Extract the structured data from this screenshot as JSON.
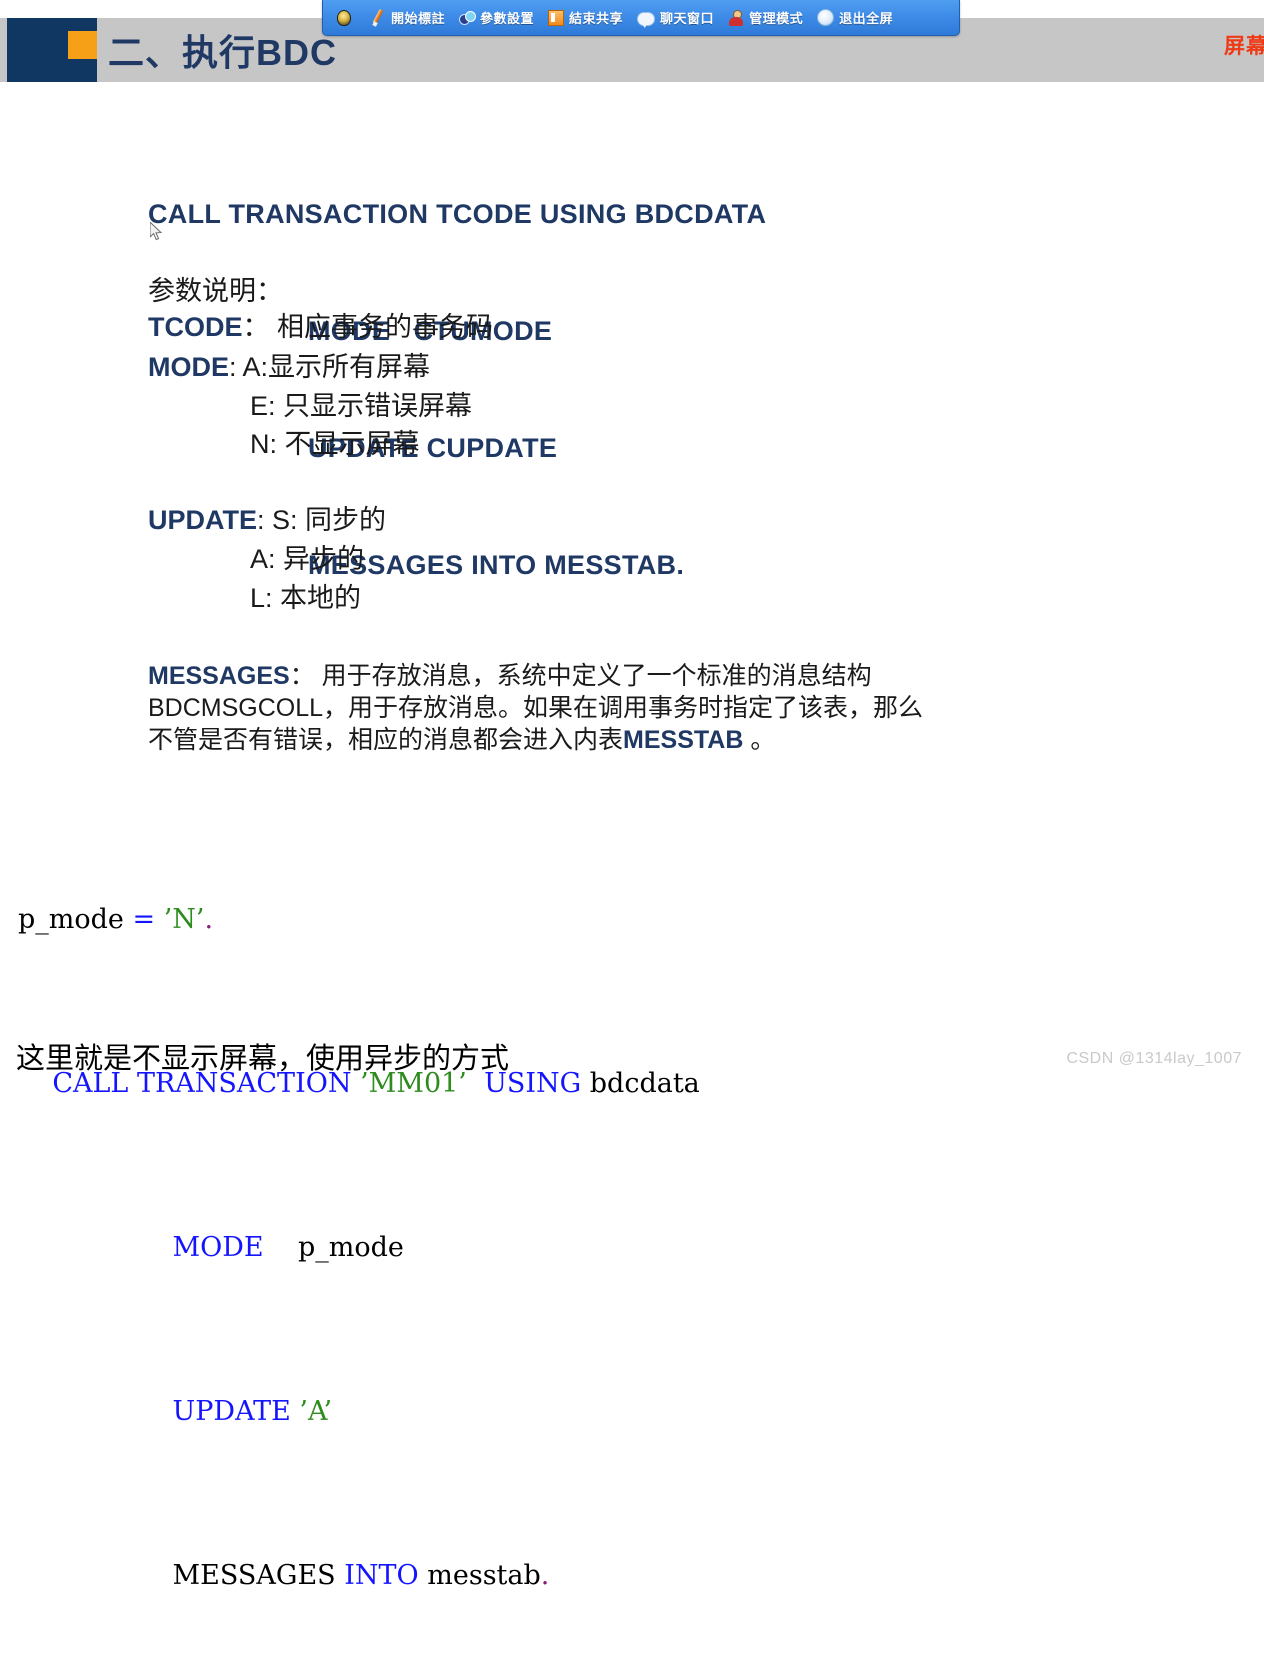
{
  "toolbar": {
    "items": [
      {
        "label": "",
        "icon": "pin-icon"
      },
      {
        "label": "開始標註",
        "icon": "pen-icon"
      },
      {
        "label": "參數設置",
        "icon": "settings-icon"
      },
      {
        "label": "結束共享",
        "icon": "stop-share-icon"
      },
      {
        "label": "聊天窗口",
        "icon": "chat-icon"
      },
      {
        "label": "管理模式",
        "icon": "admin-person-icon"
      },
      {
        "label": "退出全屏",
        "icon": "exit-fullscreen-icon"
      }
    ]
  },
  "header": {
    "title": "二、执行BDC",
    "right_text": "屏幕",
    "navy_color": "#103662",
    "accent_color": "#f5a017",
    "band_color": "#c6c6c6",
    "title_color": "#1f3864"
  },
  "slide": {
    "statement": {
      "line1": "CALL TRANSACTION TCODE USING BDCDATA",
      "line2": "MODE   CTUMODE",
      "line3": "UPDATE CUPDATE",
      "line4": "MESSAGES INTO MESSTAB."
    },
    "param_title": "参数说明：",
    "params": [
      {
        "key": "TCODE",
        "sep": "：",
        "value": " 相应事务的事务码"
      },
      {
        "key": "MODE",
        "sep": ":",
        "value": " A:显示所有屏幕"
      },
      {
        "key": "",
        "sep": "",
        "value": "E: 只显示错误屏幕"
      },
      {
        "key": "",
        "sep": "",
        "value": "N: 不显示屏幕"
      },
      {
        "key": "UPDATE",
        "sep": ":",
        "value": " S: 同步的"
      },
      {
        "key": "",
        "sep": "",
        "value": "A: 异步的"
      },
      {
        "key": "",
        "sep": "",
        "value": "L: 本地的"
      }
    ],
    "messages": {
      "keyword": "MESSAGES",
      "line1_rest": "： 用于存放消息，系统中定义了一个标准的消息结构",
      "line2": "BDCMSGCOLL，用于存放消息。如果在调用事务时指定了该表，那么",
      "line3_pre": "不管是否有错误，相应的消息都会进入内表",
      "line3_kw": "MESSTAB",
      "line3_post": " 。"
    },
    "code": {
      "l1_name": "p_mode ",
      "l1_eq": "= ",
      "l1_val": "’N’",
      "l1_dot": ".",
      "l2_indent": "    ",
      "l2_kw1": "CALL TRANSACTION ",
      "l2_val": "’MM01’",
      "l2_kw2": "  USING ",
      "l2_var": "bdcdata",
      "l3_indent": "                  ",
      "l3_kw": "MODE",
      "l3_var": "    p_mode",
      "l4_indent": "                  ",
      "l4_kw": "UPDATE ",
      "l4_val": "’A’",
      "l5_indent": "                  ",
      "l5_w1": "MESSAGES ",
      "l5_kw": "INTO",
      "l5_var": " messtab",
      "l5_dot": "."
    },
    "caption": "这里就是不显示屏幕，使用异步的方式"
  },
  "watermark": "CSDN @1314lay_1007"
}
